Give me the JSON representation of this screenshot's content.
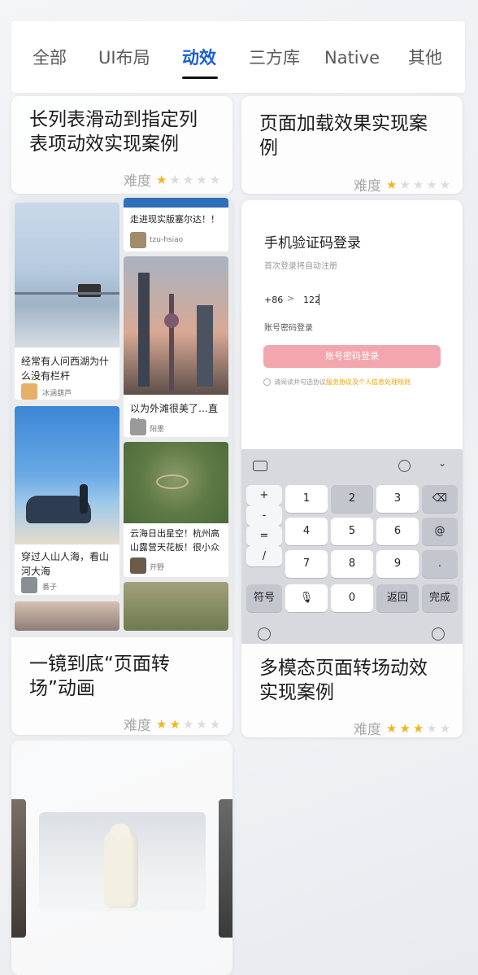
{
  "tabs": [
    {
      "label": "全部",
      "active": false
    },
    {
      "label": "UI布局",
      "active": false
    },
    {
      "label": "动效",
      "active": true
    },
    {
      "label": "三方库",
      "active": false
    },
    {
      "label": "Native",
      "active": false
    },
    {
      "label": "其他",
      "active": false
    }
  ],
  "difficulty_label": "难度",
  "cards": {
    "long_list": {
      "title_line1": "长列表滑动到指定列",
      "title_line2": "表项动效实现案例",
      "stars": 1
    },
    "page_load": {
      "title_line1": "页面加载效果实现案",
      "title_line2": "例",
      "stars": 1
    },
    "one_shot": {
      "title_line1": "一镜到底“页面转",
      "title_line2": "场”动画",
      "stars": 2
    },
    "multimodal": {
      "title_line1": "多模态页面转场动效",
      "title_line2": "实现案例",
      "stars": 3
    }
  },
  "feed": {
    "post1_text": "经常有人问西湖为什么没有栏杆",
    "post1_user": "冰涵葫芦",
    "post2_text": "走进现实版塞尔达！！",
    "post2_user": "tzu-hsiao",
    "post3_text": "以为外滩很美了…直到",
    "post3_user": "阳墨",
    "post4_text": "穿过人山人海，看山河大海",
    "post4_user": "番子",
    "post5_text": "云海日出星空！杭州高山露营天花板！很小众",
    "post5_user": "开野"
  },
  "login": {
    "title": "手机验证码登录",
    "subtitle": "首次登录将自动注册",
    "country_code": "+86",
    "chevron": ">",
    "phone_value": "122",
    "password_login_link": "账号密码登录",
    "button_label": "账号密码登录",
    "agree_prefix": "请阅读并勾选协议",
    "agree_link": "服务协议及个人信息处理规则"
  },
  "keyboard": {
    "side_keys": [
      "+",
      "-",
      "=",
      "/"
    ],
    "digits": [
      "1",
      "2",
      "3",
      "4",
      "5",
      "6",
      "7",
      "8",
      "9",
      "0"
    ],
    "backspace": "⌫",
    "at": "@",
    "dot": ".",
    "symbols": "符号",
    "back": "返回",
    "done": "完成"
  },
  "colors": {
    "accent": "#1a5fd6",
    "star_on": "#f2b51c",
    "star_off": "#dcdcdc",
    "login_button": "#f3a6ad",
    "agreement_link": "#f2a100"
  }
}
